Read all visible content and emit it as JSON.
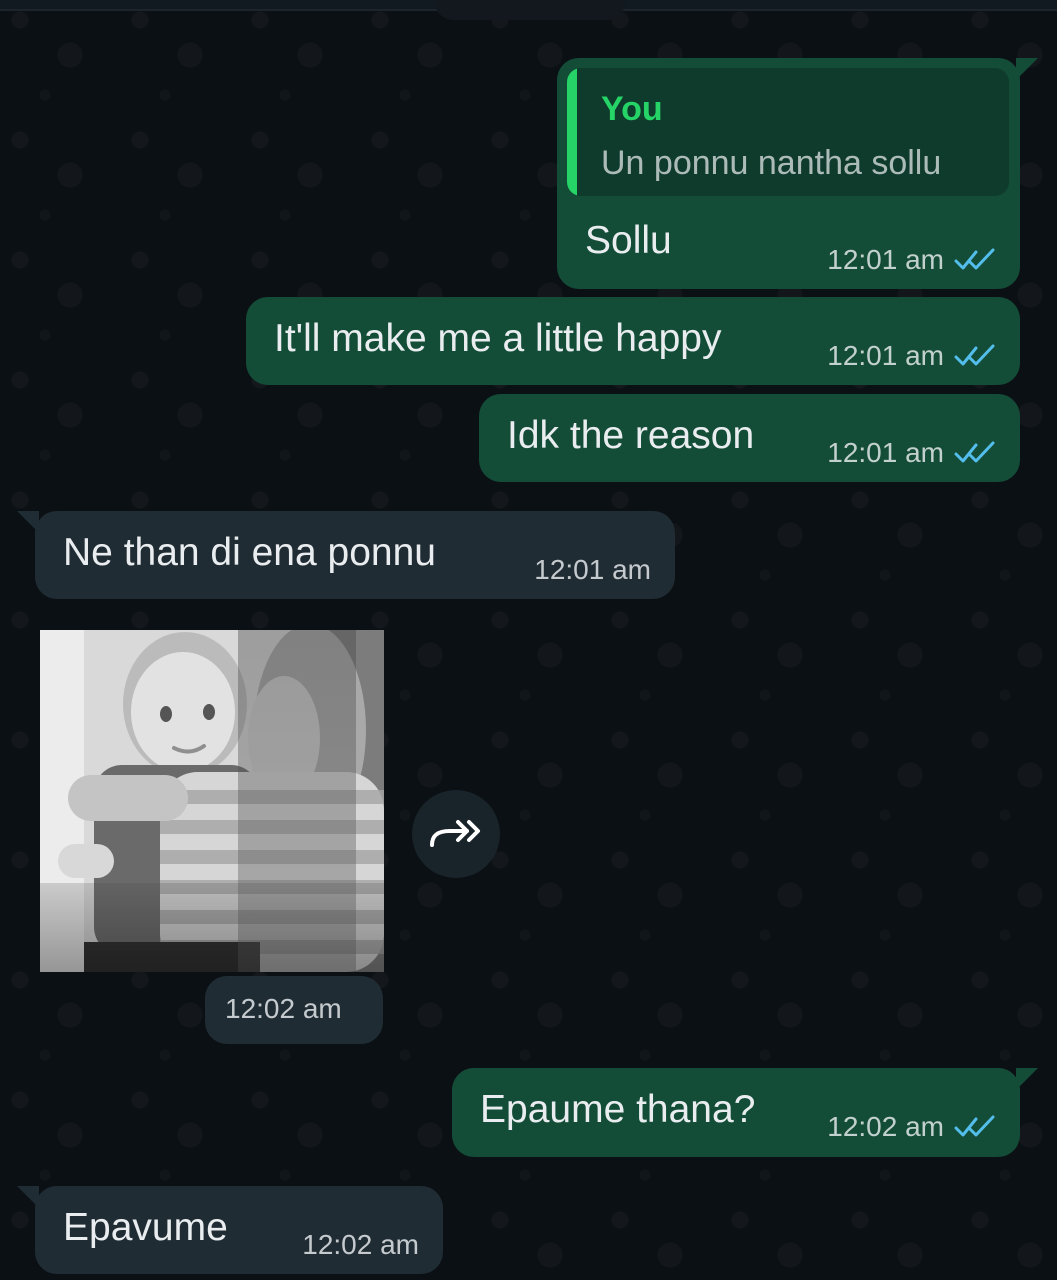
{
  "chat": {
    "messages": [
      {
        "direction": "outgoing",
        "quoted_author": "You",
        "quoted_text": "Un ponnu nantha sollu",
        "text": "Sollu",
        "time": "12:01 am",
        "read": true
      },
      {
        "direction": "outgoing",
        "text": "It'll make me a little happy",
        "time": "12:01 am",
        "read": true
      },
      {
        "direction": "outgoing",
        "text": "Idk the reason",
        "time": "12:01 am",
        "read": true
      },
      {
        "direction": "incoming",
        "text": "Ne than di ena ponnu",
        "time": "12:01 am"
      },
      {
        "direction": "incoming",
        "type": "image",
        "time": "12:02 am"
      },
      {
        "direction": "outgoing",
        "text": "Epaume thana?",
        "time": "12:02 am",
        "read": true
      },
      {
        "direction": "incoming",
        "text": "Epavume",
        "time": "12:02 am"
      }
    ]
  },
  "colors": {
    "background": "#0b1014",
    "outgoing_bubble": "#144d37",
    "incoming_bubble": "#202c33",
    "accent_green": "#25d366",
    "read_tick": "#53bdeb"
  },
  "icons": {
    "read_receipt": "double-check-icon",
    "forward": "forward-icon"
  }
}
